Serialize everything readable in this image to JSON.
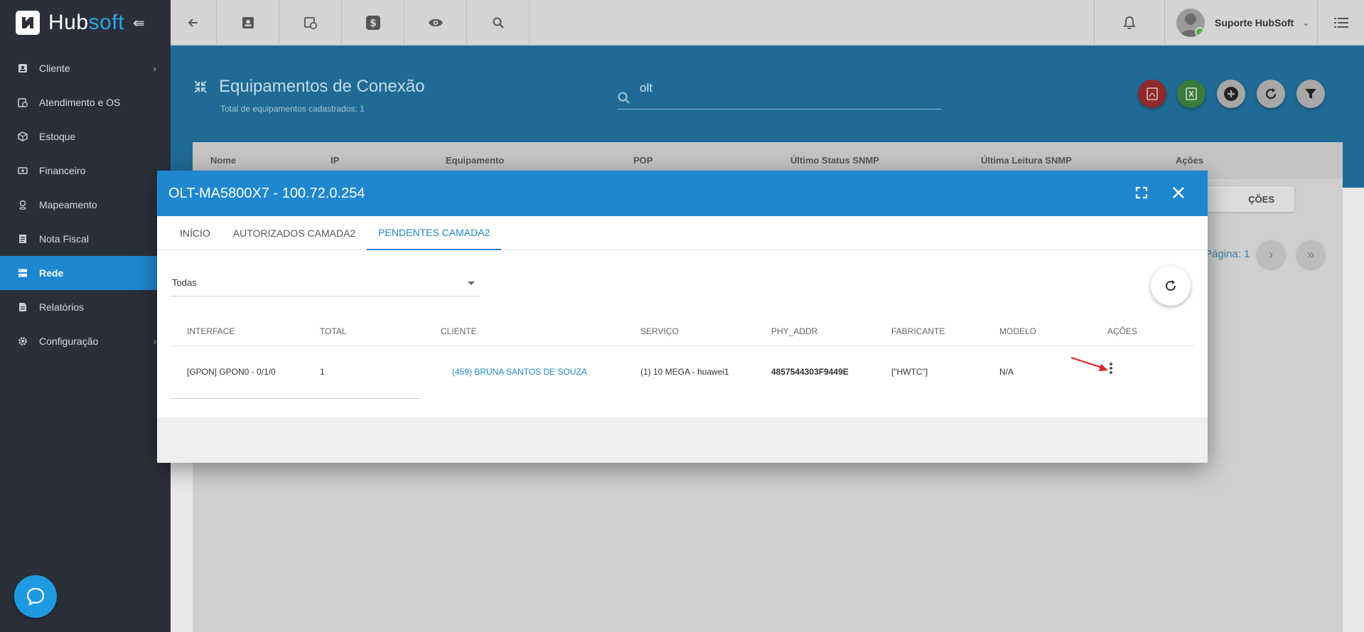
{
  "app": {
    "logo_prefix": "Hub",
    "logo_suffix": "soft"
  },
  "sidebar": {
    "items": [
      {
        "label": "Cliente",
        "icon": "contact-card-icon"
      },
      {
        "label": "Atendimento e OS",
        "icon": "clipboard-clock-icon"
      },
      {
        "label": "Estoque",
        "icon": "box-icon"
      },
      {
        "label": "Financeiro",
        "icon": "money-icon"
      },
      {
        "label": "Mapeamento",
        "icon": "map-pin-icon"
      },
      {
        "label": "Nota Fiscal",
        "icon": "invoice-icon"
      },
      {
        "label": "Rede",
        "icon": "server-icon"
      },
      {
        "label": "Relatórios",
        "icon": "report-icon"
      },
      {
        "label": "Configuração",
        "icon": "gear-icon"
      }
    ]
  },
  "topbar": {
    "user_name": "Suporte HubSoft"
  },
  "page": {
    "title": "Equipamentos de Conexão",
    "subtitle": "Total de equipamentos cadastrados: 1",
    "search_value": "olt"
  },
  "background_table": {
    "columns": [
      "Nome",
      "IP",
      "Equipamento",
      "POP",
      "Último Status SNMP",
      "Última Leitura SNMP",
      "Ações"
    ],
    "action_button": "ÇÕES",
    "page_label": "Página: 1"
  },
  "dialog": {
    "title": "OLT-MA5800X7 - 100.72.0.254",
    "tabs": [
      "INÍCIO",
      "AUTORIZADOS CAMADA2",
      "PENDENTES CAMADA2"
    ],
    "active_tab": 2,
    "filter_value": "Todas",
    "columns": [
      "INTERFACE",
      "TOTAL",
      "CLIENTE",
      "SERVIÇO",
      "PHY_ADDR",
      "FABRICANTE",
      "MODELO",
      "AÇÕES"
    ],
    "rows": [
      {
        "interface": "[GPON] GPON0 - 0/1/0",
        "total": "1",
        "cliente": "(459) BRUNA SANTOS DE SOUZA",
        "servico": "(1) 10 MEGA - huawei1",
        "phy_addr": "4857544303F9449E",
        "fabricante": "[\"HWTC\"]",
        "modelo": "N/A"
      }
    ]
  },
  "colors": {
    "sidebar_bg": "#2b2f3a",
    "accent": "#1e87cf",
    "pdf_red": "#c62828",
    "excel_green": "#388e3c",
    "annotation_arrow": "#e02020"
  }
}
